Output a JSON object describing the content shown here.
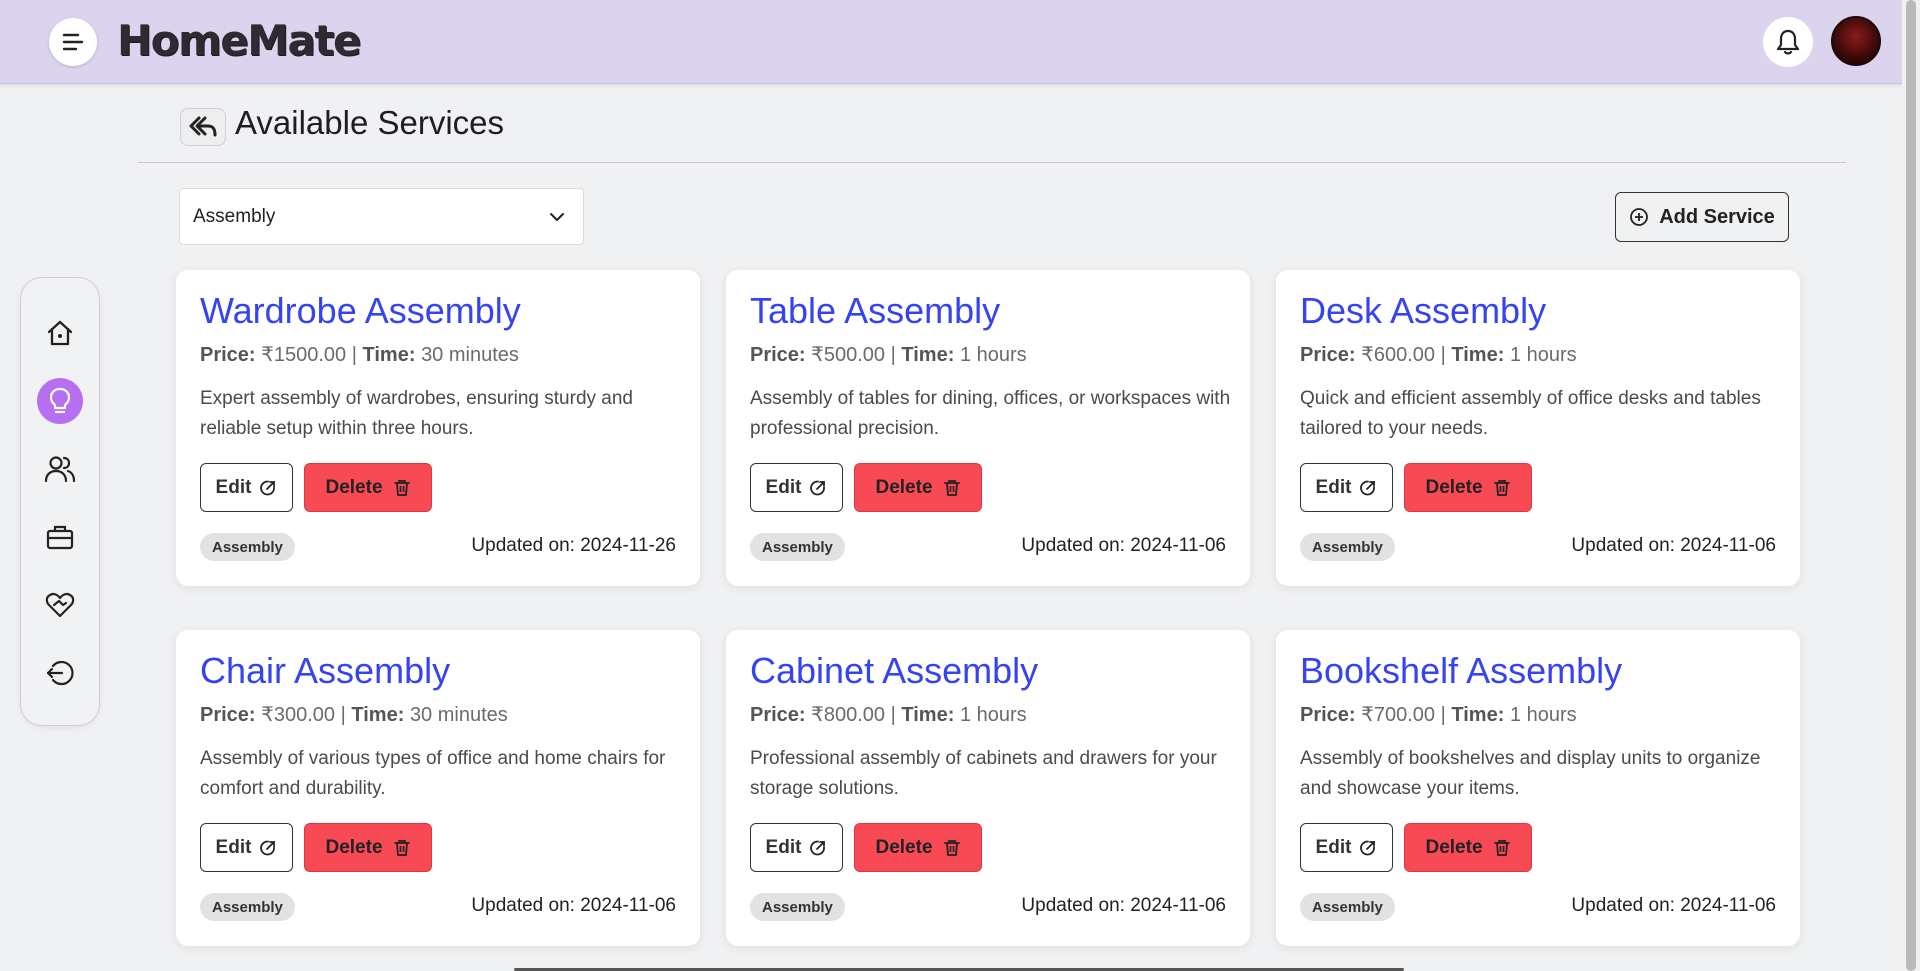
{
  "header": {
    "brand": "HomeMate"
  },
  "page": {
    "title": "Available Services",
    "category_select": "Assembly",
    "add_button": "Add Service"
  },
  "sidebar": {
    "items": [
      {
        "icon": "home-icon"
      },
      {
        "icon": "lightbulb-icon",
        "active": true
      },
      {
        "icon": "users-icon"
      },
      {
        "icon": "briefcase-icon"
      },
      {
        "icon": "heart-handshake-icon"
      },
      {
        "icon": "logout-icon"
      }
    ]
  },
  "labels": {
    "price": "Price:",
    "time": "Time:",
    "edit": "Edit",
    "delete": "Delete"
  },
  "services": [
    {
      "title": "Wardrobe Assembly",
      "price": "₹1500.00",
      "time": "30 minutes",
      "description": "Expert assembly of wardrobes, ensuring sturdy and reliable setup within three hours.",
      "tag": "Assembly",
      "updated": "Updated on: 2024-11-26"
    },
    {
      "title": "Table Assembly",
      "price": "₹500.00",
      "time": "1 hours",
      "description": "Assembly of tables for dining, offices, or workspaces with professional precision.",
      "tag": "Assembly",
      "updated": "Updated on: 2024-11-06"
    },
    {
      "title": "Desk Assembly",
      "price": "₹600.00",
      "time": "1 hours",
      "description": "Quick and efficient assembly of office desks and tables tailored to your needs.",
      "tag": "Assembly",
      "updated": "Updated on: 2024-11-06"
    },
    {
      "title": "Chair Assembly",
      "price": "₹300.00",
      "time": "30 minutes",
      "description": "Assembly of various types of office and home chairs for comfort and durability.",
      "tag": "Assembly",
      "updated": "Updated on: 2024-11-06"
    },
    {
      "title": "Cabinet Assembly",
      "price": "₹800.00",
      "time": "1 hours",
      "description": "Professional assembly of cabinets and drawers for your storage solutions.",
      "tag": "Assembly",
      "updated": "Updated on: 2024-11-06"
    },
    {
      "title": "Bookshelf Assembly",
      "price": "₹700.00",
      "time": "1 hours",
      "description": "Assembly of bookshelves and display units to organize and showcase your items.",
      "tag": "Assembly",
      "updated": "Updated on: 2024-11-06"
    }
  ]
}
